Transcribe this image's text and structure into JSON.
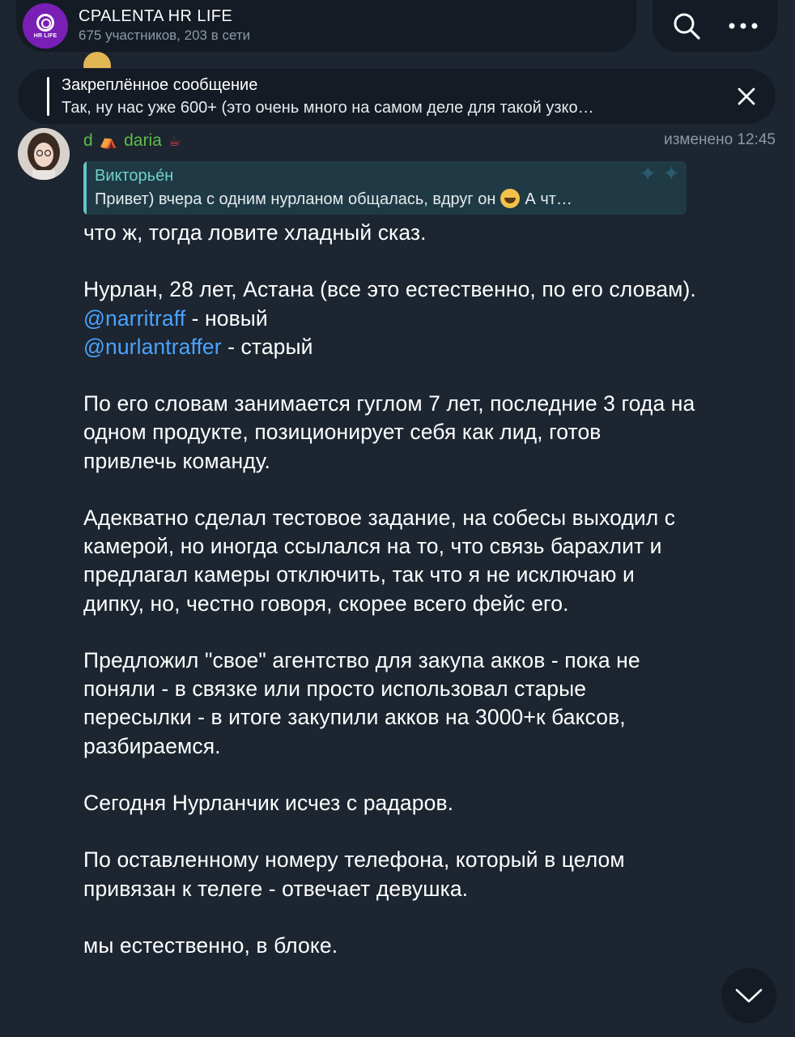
{
  "header": {
    "group_name": "CPALENTA HR LIFE",
    "group_subtitle": "675 участников, 203 в сети",
    "avatar_text": "HR LIFE"
  },
  "pinned": {
    "title": "Закреплённое сообщение",
    "text": "Так, ну нас уже 600+ (это очень много на самом деле для такой узко…"
  },
  "message": {
    "sender_prefix": "d",
    "sender_name": "daria",
    "edited_label": "изменено 12:45",
    "reply": {
      "author": "Викторье́н",
      "text_before": "Привет) вчера с одним нурланом общалась, вдруг он",
      "text_after": "А чт…"
    },
    "lines": {
      "p1": "что ж, тогда ловите хладный сказ.",
      "p2": "Нурлан, 28 лет, Астана (все это естественно, по его словам).",
      "mention1": "@narritraff",
      "mention1_suffix": " - новый",
      "mention2": "@nurlantraffer",
      "mention2_suffix": " - старый",
      "p3": "По его словам занимается гуглом 7 лет, последние 3 года на одном продукте, позиционирует себя как лид, готов привлечь команду.",
      "p4": "Адекватно сделал тестовое задание, на собесы выходил с камерой, но иногда ссылался на то, что связь барахлит и предлагал камеры отключить, так что я не исключаю и дипку, но, честно говоря, скорее всего фейс его.",
      "p5": "Предложил \"свое\" агентство для закупа акков - пока не поняли - в связке или просто использовал старые пересылки - в итоге закупили акков на 3000+к баксов, разбираемся.",
      "p6": "Сегодня Нурланчик исчез с радаров.",
      "p7": "По оставленному номеру телефона, который в целом привязан к телеге - отвечает девушка.",
      "p8": "мы естественно, в блоке."
    }
  },
  "colors": {
    "background": "#1c2530",
    "pill": "#141b24",
    "sender": "#5ebd48",
    "mention": "#4aa3ff",
    "reply_author": "#6fd0cc",
    "muted": "#8d98a5"
  },
  "icons": {
    "search": "search-icon",
    "more": "more-dots-icon",
    "close": "close-icon",
    "scroll": "chevron-down-icon"
  }
}
